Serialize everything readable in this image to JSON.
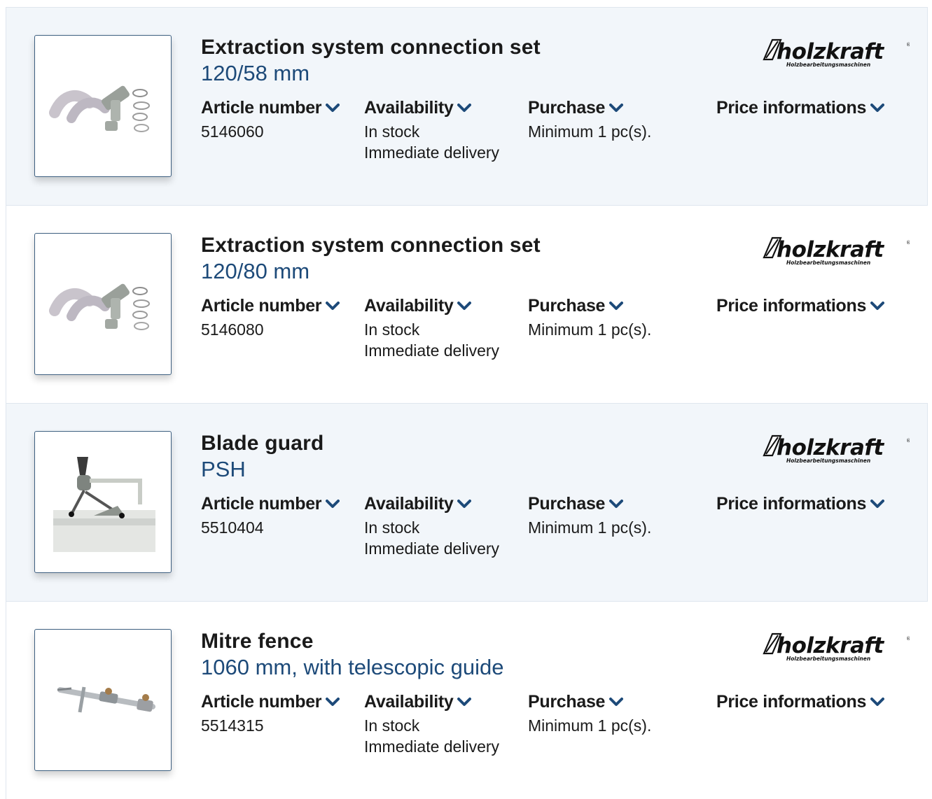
{
  "labels": {
    "article_number": "Article number",
    "availability": "Availability",
    "purchase": "Purchase",
    "price_informations": "Price informations"
  },
  "brand": {
    "name": "holzkraft",
    "tagline": "Holzbearbeitungsmaschinen"
  },
  "colors": {
    "accent": "#1d4a79",
    "row_alt_bg": "#f2f6fa",
    "thumb_border": "#3d5f80"
  },
  "products": [
    {
      "title": "Extraction system connection set",
      "subtitle": "120/58 mm",
      "article_number": "5146060",
      "availability": [
        "In stock",
        "Immediate delivery"
      ],
      "purchase": "Minimum 1 pc(s).",
      "image": "extraction-connection-set-image"
    },
    {
      "title": "Extraction system connection set",
      "subtitle": "120/80 mm",
      "article_number": "5146080",
      "availability": [
        "In stock",
        "Immediate delivery"
      ],
      "purchase": "Minimum 1 pc(s).",
      "image": "extraction-connection-set-image"
    },
    {
      "title": "Blade guard",
      "subtitle": "PSH",
      "article_number": "5510404",
      "availability": [
        "In stock",
        "Immediate delivery"
      ],
      "purchase": "Minimum 1 pc(s).",
      "image": "blade-guard-image"
    },
    {
      "title": "Mitre fence",
      "subtitle": "1060 mm, with telescopic guide",
      "article_number": "5514315",
      "availability": [
        "In stock",
        "Immediate delivery"
      ],
      "purchase": "Minimum 1 pc(s).",
      "image": "mitre-fence-image"
    }
  ]
}
